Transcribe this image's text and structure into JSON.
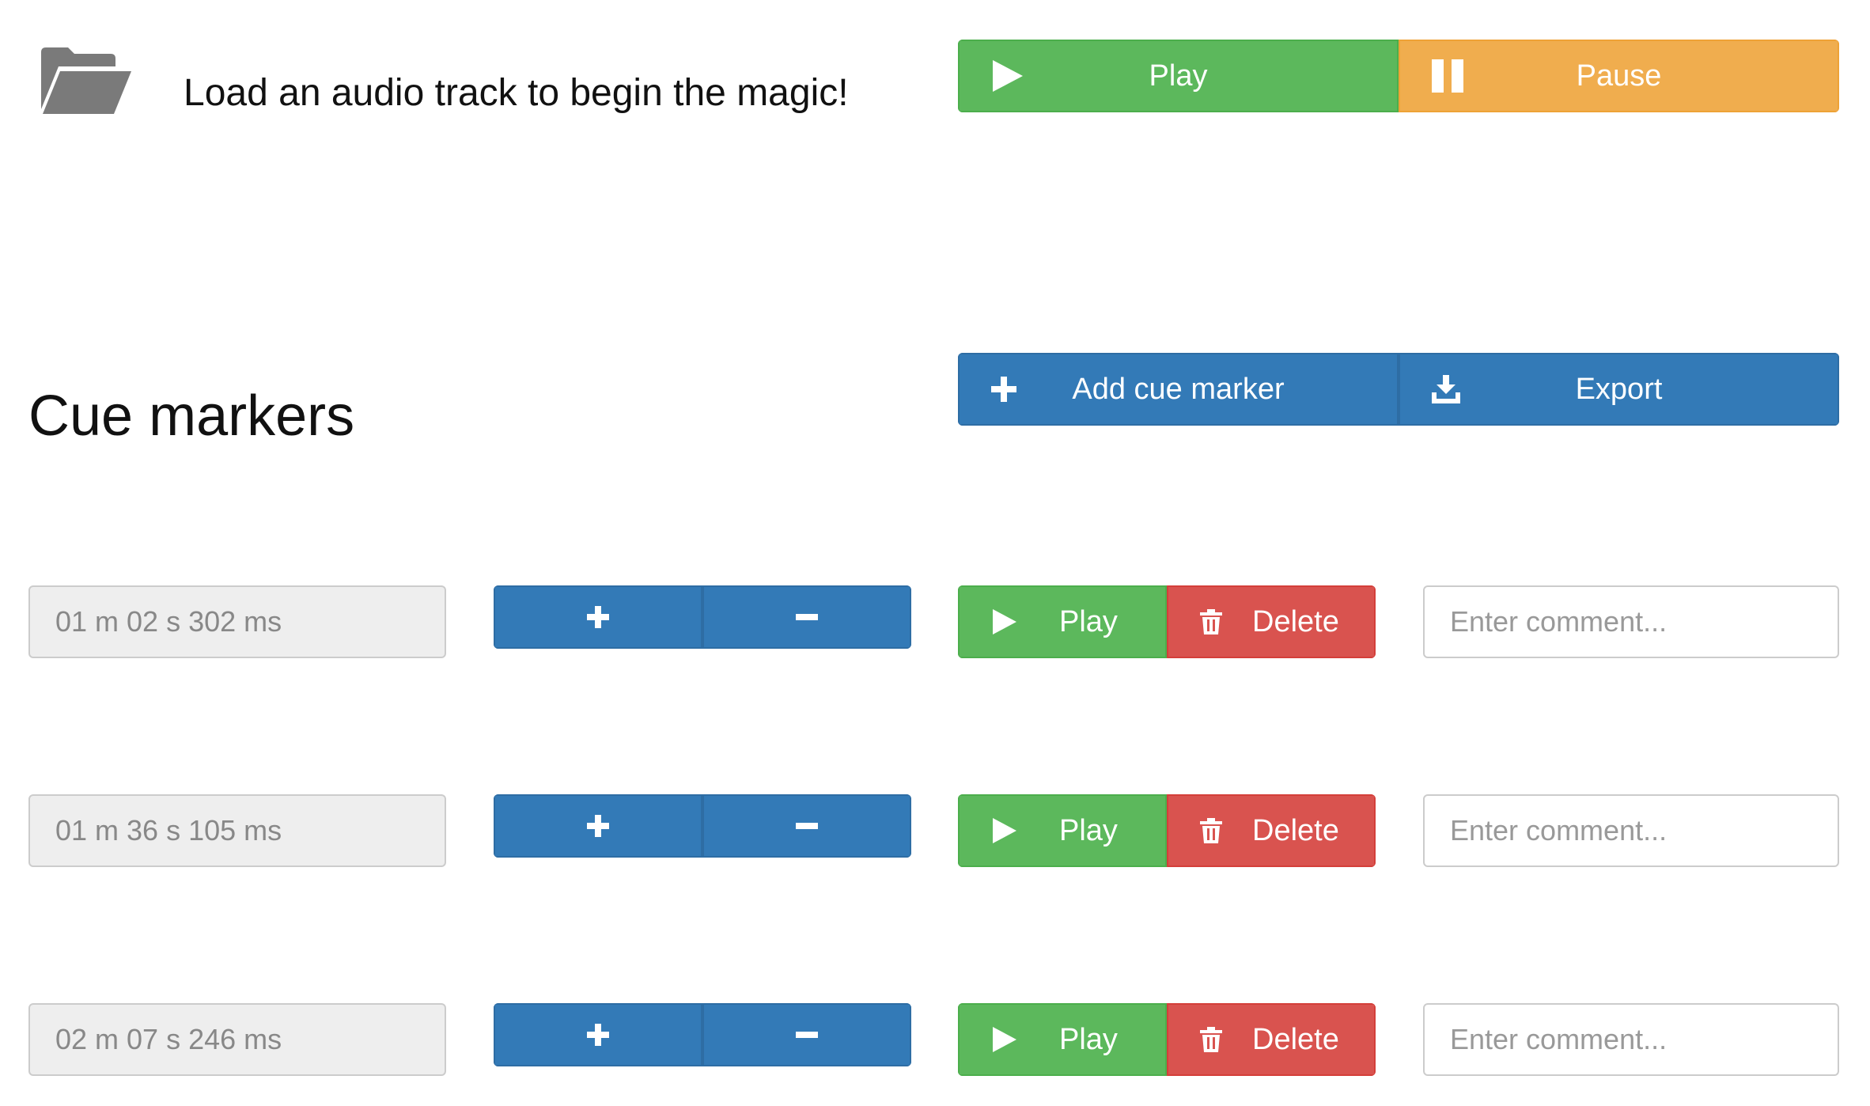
{
  "header": {
    "folder_icon": "folder-open-icon",
    "load_prompt": "Load an audio track to begin the magic!"
  },
  "transport": {
    "play_label": "Play",
    "pause_label": "Pause"
  },
  "cue_section": {
    "title": "Cue markers",
    "add_label": "Add cue marker",
    "export_label": "Export"
  },
  "cues": [
    {
      "time": "01 m 02 s 302 ms",
      "play_label": "Play",
      "delete_label": "Delete",
      "comment_placeholder": "Enter comment..."
    },
    {
      "time": "01 m 36 s 105 ms",
      "play_label": "Play",
      "delete_label": "Delete",
      "comment_placeholder": "Enter comment..."
    },
    {
      "time": "02 m 07 s 246 ms",
      "play_label": "Play",
      "delete_label": "Delete",
      "comment_placeholder": "Enter comment..."
    }
  ],
  "colors": {
    "success": "#5cb85c",
    "warning": "#f0ad4e",
    "primary": "#337ab7",
    "danger": "#d9534f"
  }
}
